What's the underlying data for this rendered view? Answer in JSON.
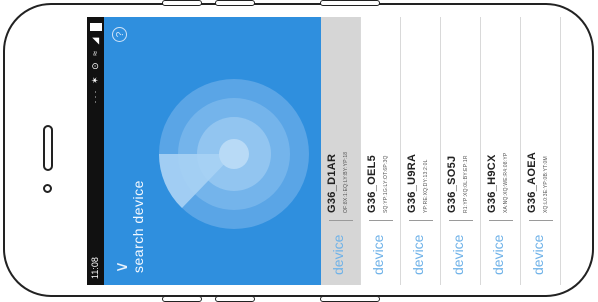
{
  "status": {
    "time": "11:08",
    "icons": "··· ✶ ⊙ ≈ ◢"
  },
  "header": {
    "title": "search device",
    "back_icon": "chevron-down-icon",
    "help_icon": "help-circle-icon",
    "help_glyph": "?",
    "back_glyph": "∨"
  },
  "colors": {
    "accent": "#2f8fde",
    "device_label": "#6fb2e8",
    "selected_row": "#d6d6d6"
  },
  "devices": [
    {
      "type": "device",
      "name": "G36_D1AR",
      "mac": "OF:8X:1:EQ:LY:BY:YP:18",
      "selected": true
    },
    {
      "type": "device",
      "name": "G36_OEL5",
      "mac": "SQ:YP:1G:LY:OT:6P:3Q",
      "selected": false
    },
    {
      "type": "device",
      "name": "G36_U9RA",
      "mac": "YP:RE:XQ:DY:13:2:0L",
      "selected": false
    },
    {
      "type": "device",
      "name": "G36_SO5J",
      "mac": "R1:YP:XQ:0L:BY:EP:1R",
      "selected": false
    },
    {
      "type": "device",
      "name": "G36_H9CX",
      "mac": "XA:NQ:XQ:WE:R4:08:YP",
      "selected": false
    },
    {
      "type": "device",
      "name": "G36_AOEA",
      "mac": "XQ:L0:3E:YP:0B:YT:0M",
      "selected": false
    }
  ]
}
